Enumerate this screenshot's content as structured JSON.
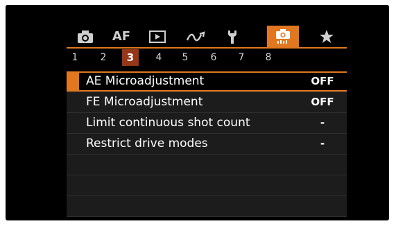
{
  "tabs": [
    {
      "name": "shooting",
      "icon": "camera-icon",
      "label": ""
    },
    {
      "name": "af",
      "icon": "af-icon",
      "label": "AF"
    },
    {
      "name": "playback",
      "icon": "playback-icon",
      "label": ""
    },
    {
      "name": "wireless",
      "icon": "wireless-icon",
      "label": ""
    },
    {
      "name": "setup",
      "icon": "wrench-icon",
      "label": ""
    },
    {
      "name": "custom-functions",
      "icon": "custom-camera-icon",
      "label": "",
      "active": true
    },
    {
      "name": "my-menu",
      "icon": "star-icon",
      "label": ""
    }
  ],
  "pages": [
    "1",
    "2",
    "3",
    "4",
    "5",
    "6",
    "7",
    "8"
  ],
  "active_page": "3",
  "menu": {
    "items": [
      {
        "label": "AE Microadjustment",
        "value": "OFF",
        "selected": true
      },
      {
        "label": "FE Microadjustment",
        "value": "OFF"
      },
      {
        "label": "Limit continuous shot count",
        "value": "-"
      },
      {
        "label": "Restrict drive modes",
        "value": "-"
      },
      {
        "label": "",
        "value": ""
      },
      {
        "label": "",
        "value": ""
      },
      {
        "label": "",
        "value": ""
      }
    ]
  },
  "colors": {
    "accent": "#e1781f",
    "active_page_bg": "#96371a",
    "background": "#000000"
  }
}
